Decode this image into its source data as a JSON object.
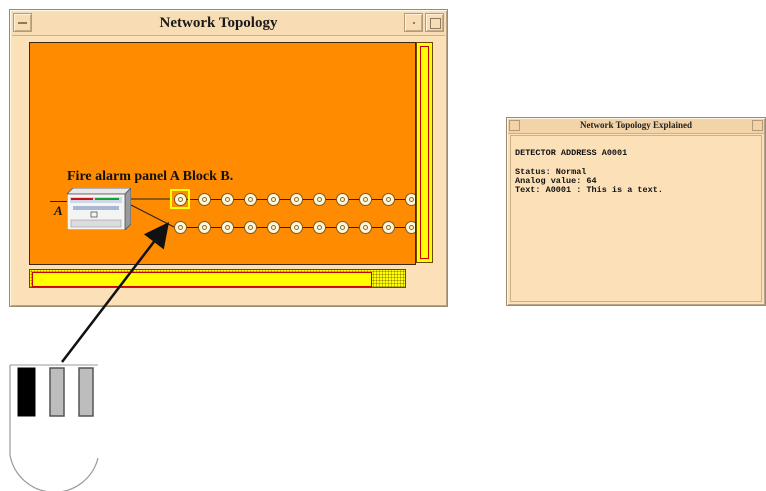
{
  "main_window": {
    "title": "Network Topology",
    "panel_label": "Fire alarm panel A Block B.",
    "line_label": "A",
    "detector_rows": 2,
    "detectors_per_row": 10
  },
  "explain_window": {
    "title": "Network Topology Explained",
    "heading": "DETECTOR ADDRESS A0001",
    "status_line": "Status: Normal",
    "analog_line": "Analog value: 64",
    "text_line": "Text: A0001 : This is a text."
  },
  "colors": {
    "canvas": "#ff8c00",
    "scrollbar": "#ffff00",
    "window_bg": "#fbe0b8",
    "selection": "#ffff00"
  },
  "icons": [
    "window-menu-icon",
    "minimize-icon",
    "maximize-icon",
    "fire-alarm-panel-icon",
    "detector-icon",
    "smoke-detector-illustration"
  ]
}
